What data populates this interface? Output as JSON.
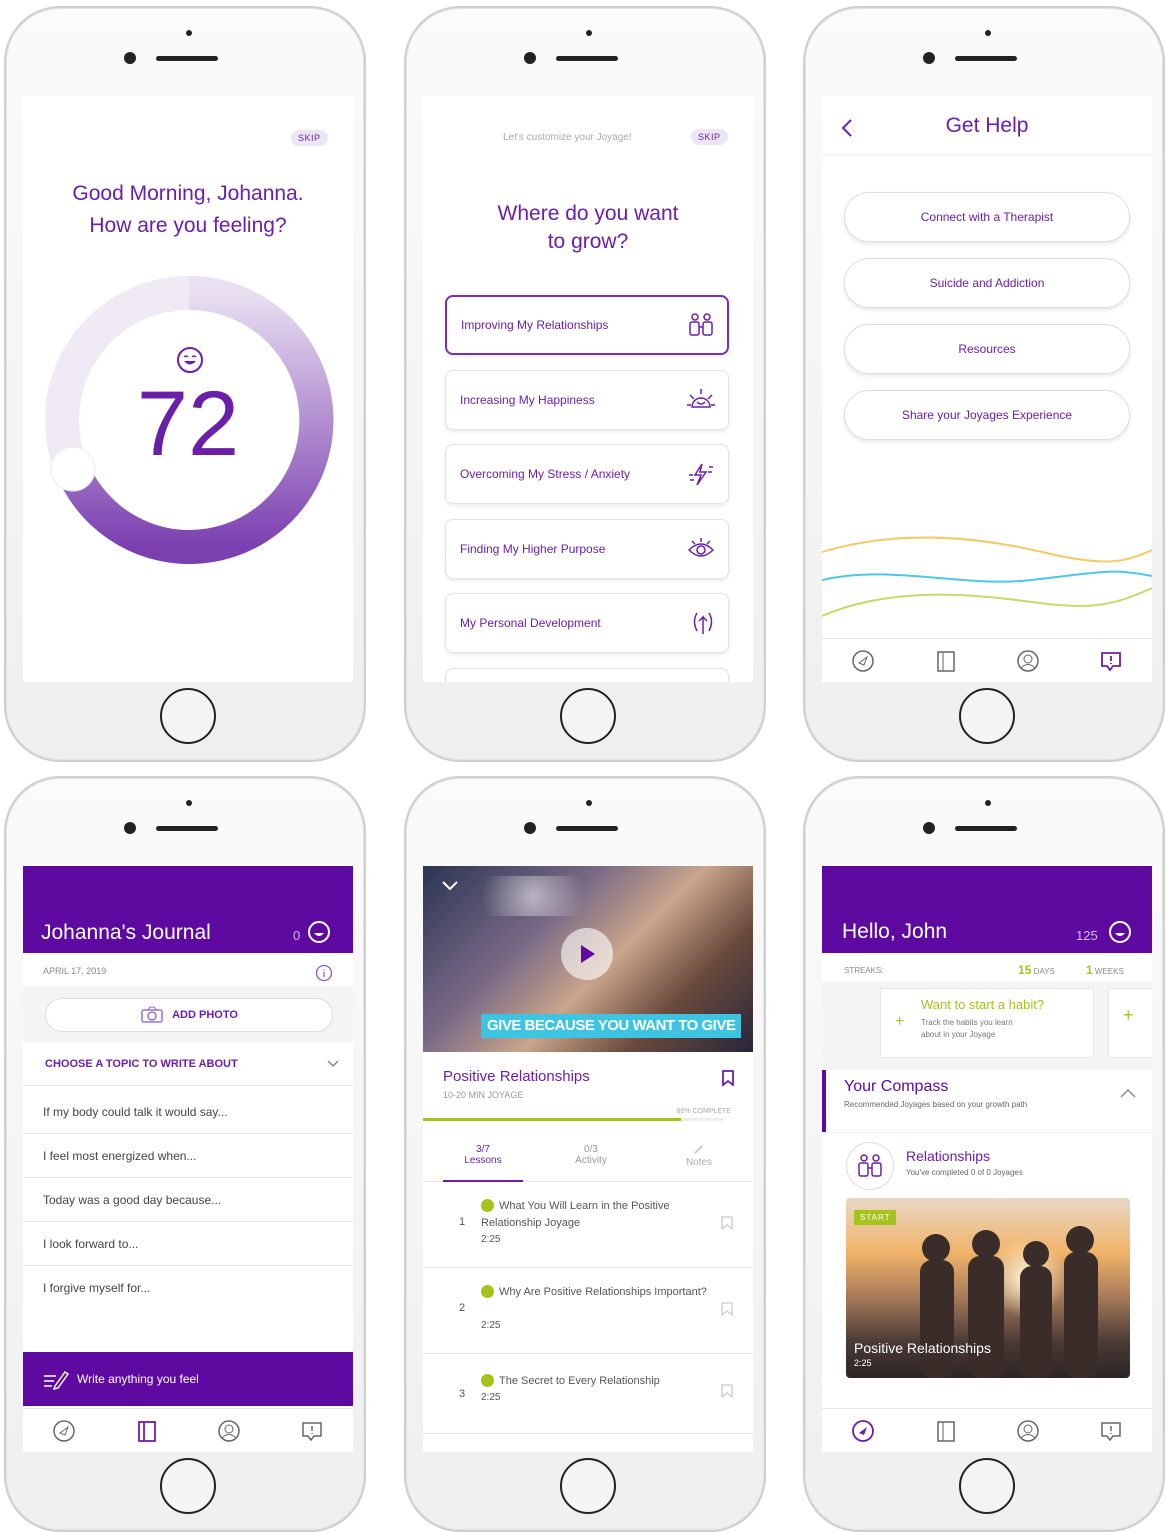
{
  "s1": {
    "skip": "SKIP",
    "greeting": "Good Morning, Johanna.",
    "question": "How are you feeling?",
    "score": "72"
  },
  "s2": {
    "subtitle": "Let's customize your Joyage!",
    "skip": "SKIP",
    "title_1": "Where do you want",
    "title_2": "to grow?",
    "options": [
      {
        "label": "Improving My Relationships",
        "icon": "relationships-icon"
      },
      {
        "label": "Increasing My Happiness",
        "icon": "sun-icon"
      },
      {
        "label": "Overcoming My Stress / Anxiety",
        "icon": "lightning-icon"
      },
      {
        "label": "Finding My Higher Purpose",
        "icon": "eye-icon"
      },
      {
        "label": "My Personal Development",
        "icon": "growth-icon"
      }
    ]
  },
  "s3": {
    "title": "Get Help",
    "buttons": [
      "Connect with a Therapist",
      "Suicide and Addiction",
      "Resources",
      "Share your Joyages Experience"
    ]
  },
  "s4": {
    "title": "Johanna's Journal",
    "points": "0",
    "date": "APRIL 17, 2019",
    "add_photo": "ADD PHOTO",
    "choose": "CHOOSE A TOPIC TO WRITE ABOUT",
    "prompts": [
      "If my body could talk it would say...",
      "I feel most energized when...",
      "Today was a good day because...",
      "I look forward to...",
      "I forgive myself for..."
    ],
    "write": "Write anything you feel"
  },
  "s5": {
    "banner": "GIVE BECAUSE YOU WANT TO GIVE",
    "title": "Positive Relationships",
    "sub": "10-20 MIN JOYAGE",
    "complete": "86% COMPLETE",
    "progress": 0.86,
    "tabs": [
      {
        "count": "3/7",
        "label": "Lessons"
      },
      {
        "count": "0/3",
        "label": "Activity"
      },
      {
        "count": "",
        "label": "Notes"
      }
    ],
    "lessons": [
      {
        "num": "1",
        "title": "What You Will Learn in the Positive Relationship Joyage",
        "time": "2:25"
      },
      {
        "num": "2",
        "title": "Why Are Positive Relationships Important?",
        "time": "2:25"
      },
      {
        "num": "3",
        "title": "The Secret to Every Relationship",
        "time": "2:25"
      }
    ]
  },
  "s6": {
    "greeting": "Hello, John",
    "points": "125",
    "streaks": "STREAKS:",
    "days_n": "15",
    "days": "DAYS",
    "weeks_n": "1",
    "weeks": "WEEKS",
    "habit_title": "Want to start a habit?",
    "habit_desc_1": "Track the habits you learn",
    "habit_desc_2": "about in your Joyage",
    "compass": "Your Compass",
    "compass_sub": "Recommended Joyages based on your growth path",
    "rel": "Relationships",
    "rel_sub": "You've completed 0 of 0 Joyages",
    "start": "START",
    "card_title": "Positive Relationships",
    "card_time": "2:25"
  },
  "colors": {
    "purple": "#5e0aa0",
    "accent": "#7b2cbf",
    "green": "#a6c21c"
  }
}
